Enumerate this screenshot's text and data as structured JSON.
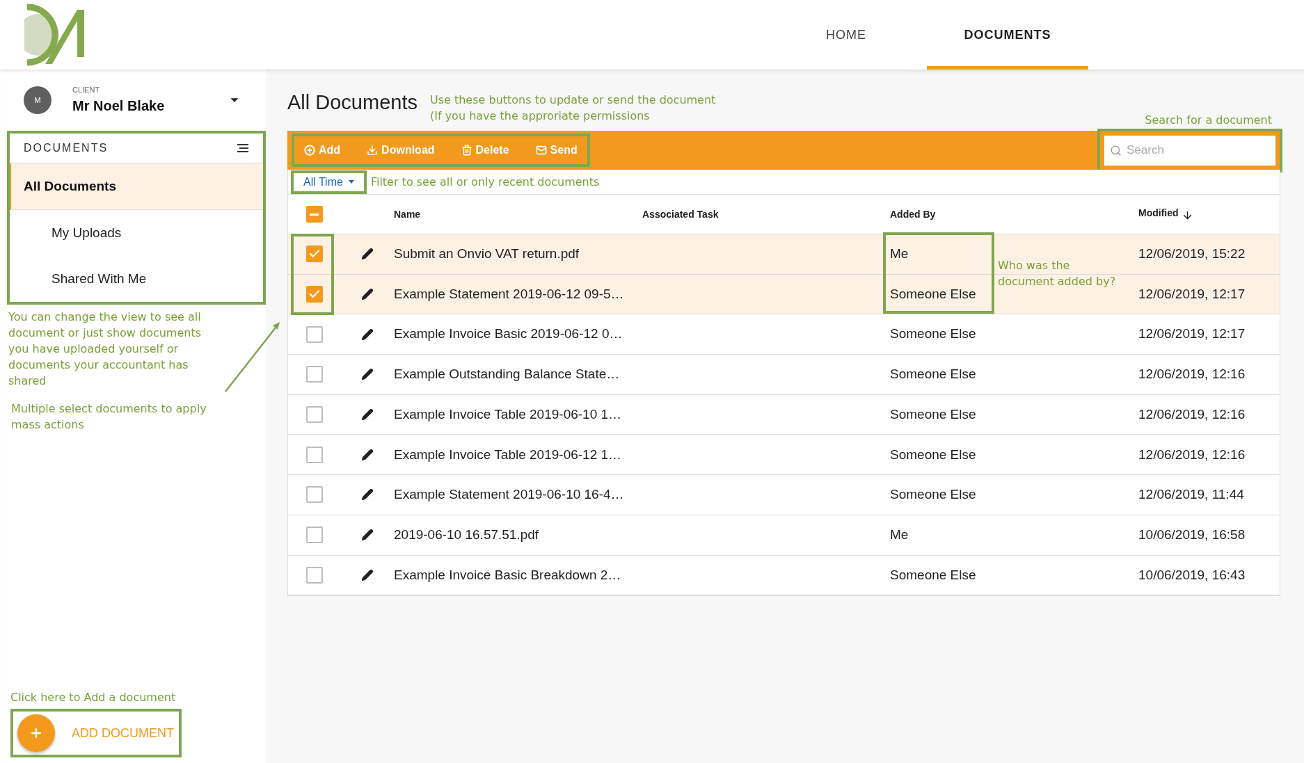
{
  "header": {
    "nav": [
      {
        "label": "HOME",
        "selected": false
      },
      {
        "label": "DOCUMENTS",
        "selected": true
      }
    ]
  },
  "client": {
    "avatar": "M",
    "caption": "CLIENT",
    "name": "Mr Noel Blake"
  },
  "sidebar": {
    "title": "DOCUMENTS",
    "items": [
      {
        "label": "All Documents",
        "selected": true
      },
      {
        "label": "My Uploads",
        "selected": false
      },
      {
        "label": "Shared With Me",
        "selected": false
      }
    ]
  },
  "notes": {
    "view": "You can change the view to see all document or just show documents you have uploaded yourself or documents your accountant has shared",
    "multi": "Multiple select documents to apply mass actions",
    "buttons": "Use these buttons to update or send the document\n(If you have the approriate permissions",
    "search": "Search for a document",
    "filter": "Filter to see all or only recent documents",
    "added_by": "Who was the\ndocument added by?",
    "add": "Click here to Add a document"
  },
  "page": {
    "title": "All Documents"
  },
  "toolbar": {
    "actions": [
      {
        "kind": "add",
        "label": "Add"
      },
      {
        "kind": "download",
        "label": "Download"
      },
      {
        "kind": "delete",
        "label": "Delete"
      },
      {
        "kind": "send",
        "label": "Send"
      }
    ],
    "search": {
      "placeholder": "Search"
    }
  },
  "filter": {
    "value": "All Time"
  },
  "table": {
    "select_all": {
      "mixed": true
    },
    "columns": [
      "Name",
      "Associated Task",
      "Added By",
      "Modified"
    ],
    "rows": [
      {
        "checked": true,
        "name": "Submit an Onvio VAT return.pdf",
        "added_by": "Me",
        "modified": "12/06/2019, 15:22"
      },
      {
        "checked": true,
        "name": "Example Statement 2019-06-12 09-5…",
        "added_by": "Someone Else",
        "modified": "12/06/2019, 12:17"
      },
      {
        "checked": false,
        "name": "Example Invoice Basic 2019-06-12 0…",
        "added_by": "Someone Else",
        "modified": "12/06/2019, 12:17"
      },
      {
        "checked": false,
        "name": "Example Outstanding Balance State…",
        "added_by": "Someone Else",
        "modified": "12/06/2019, 12:16"
      },
      {
        "checked": false,
        "name": "Example Invoice Table 2019-06-10 1…",
        "added_by": "Someone Else",
        "modified": "12/06/2019, 12:16"
      },
      {
        "checked": false,
        "name": "Example Invoice Table 2019-06-12 1…",
        "added_by": "Someone Else",
        "modified": "12/06/2019, 12:16"
      },
      {
        "checked": false,
        "name": "Example Statement 2019-06-10 16-4…",
        "added_by": "Someone Else",
        "modified": "12/06/2019, 11:44"
      },
      {
        "checked": false,
        "name": "2019-06-10 16.57.51.pdf",
        "added_by": "Me",
        "modified": "10/06/2019, 16:58"
      },
      {
        "checked": false,
        "name": "Example Invoice Basic Breakdown 2…",
        "added_by": "Someone Else",
        "modified": "10/06/2019, 16:43"
      }
    ]
  },
  "add_button": {
    "label": "ADD DOCUMENT"
  }
}
